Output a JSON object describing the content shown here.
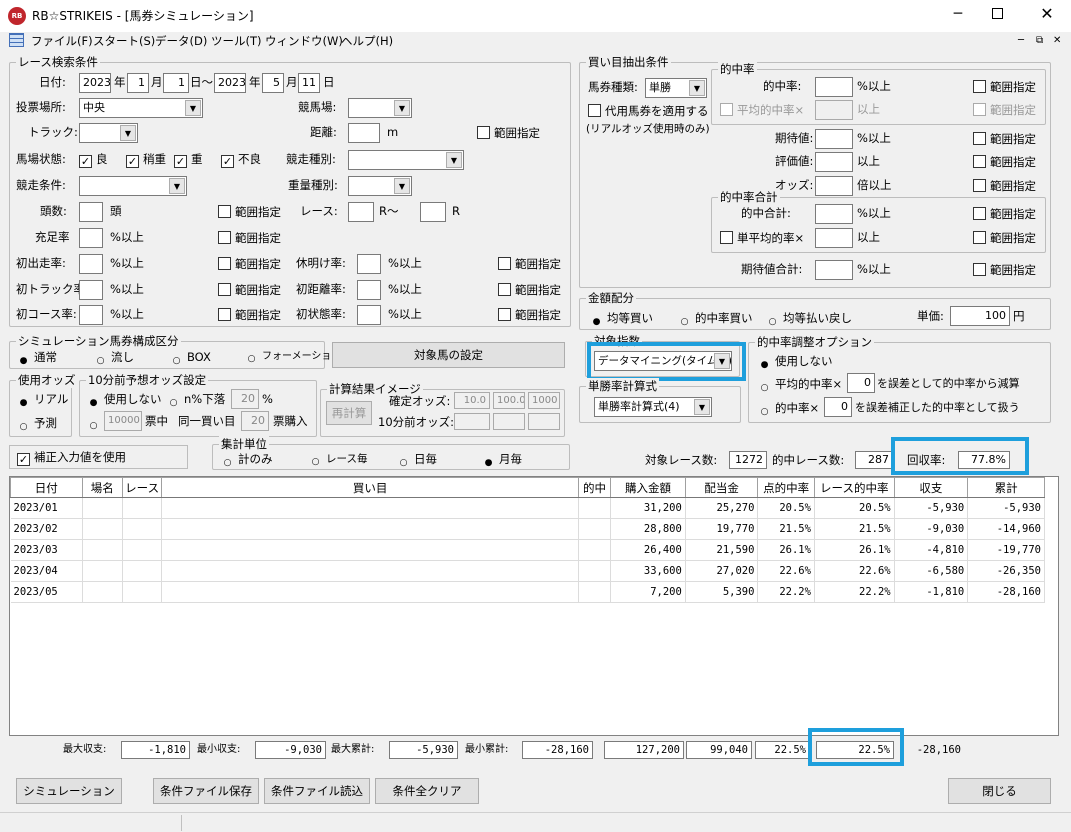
{
  "app_title": "RB☆STRIKEIS - [馬券シミュレーション]",
  "menu": [
    "ファイル(F)",
    "スタート(S)",
    "データ(D)",
    "ツール(T)",
    "ウィンドウ(W)",
    "ヘルプ(H)"
  ],
  "race": {
    "title": "レース検索条件",
    "date_label": "日付:",
    "y1": "2023",
    "year": "年",
    "m1": "1",
    "month": "月",
    "d1": "1",
    "day_sep": "日～",
    "y2": "2023",
    "m2": "5",
    "d2": "11",
    "day": "日",
    "venue_label": "投票場所:",
    "venue": "中央",
    "track_label": "競馬場:",
    "course_label": "トラック:",
    "dist_label": "距離:",
    "dist_unit": "m",
    "range": "範囲指定",
    "cond_label": "馬場状態:",
    "cond": [
      "良",
      "稍重",
      "重",
      "不良"
    ],
    "kind_label": "競走種別:",
    "cond2_label": "競走条件:",
    "weight_label": "重量種別:",
    "heads_label": "頭数:",
    "heads_unit": "頭",
    "race_label": "レース:",
    "race_unit1": "R～",
    "race_unit2": "R",
    "fill_label": "充足率",
    "pct_above": "%以上",
    "rows": [
      {
        "a": "初出走率:",
        "b": "休明け率:"
      },
      {
        "a": "初トラック率:",
        "b": "初距離率:"
      },
      {
        "a": "初コース率:",
        "b": "初状態率:"
      }
    ]
  },
  "buy": {
    "title": "買い目抽出条件",
    "type_label": "馬券種類:",
    "type": "単勝",
    "substitute": "代用馬券を適用する",
    "realodds": "(リアルオッズ使用時のみ)",
    "hit_group": "的中率",
    "hit_label": "的中率:",
    "hit_unit": "%以上",
    "avg_hit_label": "平均的中率×",
    "avg_hit_unit": "以上",
    "exp_label": "期待値:",
    "exp_unit": "%以上",
    "eval_label": "評価値:",
    "eval_unit": "以上",
    "odds_label": "オッズ:",
    "odds_unit": "倍以上",
    "total_group": "的中率合計",
    "total_label": "的中合計:",
    "total_unit": "%以上",
    "single_avg": "単平均的率×",
    "single_unit": "以上",
    "exp_total_label": "期待値合計:",
    "exp_total_unit": "%以上",
    "range": "範囲指定"
  },
  "money": {
    "title": "金額配分",
    "opts": [
      "均等買い",
      "的中率買い",
      "均等払い戻し"
    ],
    "unit_label": "単価:",
    "unit_value": "100",
    "yen": "円"
  },
  "target": {
    "title": "対象指数",
    "value": "データマイニング(タイム型)"
  },
  "adjust": {
    "title": "的中率調整オプション",
    "opt1": "使用しない",
    "opt2": "平均的中率×",
    "opt2_val": "0",
    "opt2_tail": "を誤差として的中率から減算",
    "opt3": "的中率×",
    "opt3_val": "0",
    "opt3_tail": "を誤差補正した的中率として扱う"
  },
  "single": {
    "title": "単勝率計算式",
    "value": "単勝率計算式(4)"
  },
  "sim": {
    "title": "シミュレーション馬券構成区分",
    "opts": [
      "通常",
      "流し",
      "BOX",
      "フォーメーション"
    ],
    "target_btn": "対象馬の設定"
  },
  "odds": {
    "title": "使用オッズ",
    "opts": [
      "リアル",
      "予測"
    ]
  },
  "pre10": {
    "title": "10分前予想オッズ設定",
    "use_no": "使用しない",
    "drop": "n%下落",
    "drop_val": "20",
    "pct": "%",
    "v1": "10000",
    "ticket": "票中",
    "same": "同一買い目",
    "v2": "20",
    "buy": "票購入"
  },
  "calc": {
    "title": "計算結果イメージ",
    "recalc": "再計算",
    "fixed": "確定オッズ:",
    "pre": "10分前オッズ:",
    "f1": "10.0",
    "f2": "100.0",
    "f3": "1000"
  },
  "correction": "補正入力値を使用",
  "agg": {
    "title": "集計単位",
    "opts": [
      "計のみ",
      "レース毎",
      "日毎",
      "月毎"
    ]
  },
  "stats": {
    "races_label": "対象レース数:",
    "races": "1272",
    "hits_label": "的中レース数:",
    "hits": "287",
    "rec_label": "回収率:",
    "rec": "77.8%"
  },
  "table": {
    "headers": [
      "日付",
      "場名",
      "レース",
      "買い目",
      "的中",
      "購入金額",
      "配当金",
      "点的中率",
      "レース的中率",
      "収支",
      "累計"
    ],
    "rows": [
      [
        "2023/01",
        "",
        "",
        "",
        "",
        "31,200",
        "25,270",
        "20.5%",
        "20.5%",
        "-5,930",
        "-5,930"
      ],
      [
        "2023/02",
        "",
        "",
        "",
        "",
        "28,800",
        "19,770",
        "21.5%",
        "21.5%",
        "-9,030",
        "-14,960"
      ],
      [
        "2023/03",
        "",
        "",
        "",
        "",
        "26,400",
        "21,590",
        "26.1%",
        "26.1%",
        "-4,810",
        "-19,770"
      ],
      [
        "2023/04",
        "",
        "",
        "",
        "",
        "33,600",
        "27,020",
        "22.6%",
        "22.6%",
        "-6,580",
        "-26,350"
      ],
      [
        "2023/05",
        "",
        "",
        "",
        "",
        "7,200",
        "5,390",
        "22.2%",
        "22.2%",
        "-1,810",
        "-28,160"
      ]
    ]
  },
  "summary": {
    "max_bal_l": "最大収支:",
    "max_bal": "-1,810",
    "min_bal_l": "最小収支:",
    "min_bal": "-9,030",
    "max_cum_l": "最大累計:",
    "max_cum": "-5,930",
    "min_cum_l": "最小累計:",
    "min_cum": "-28,160",
    "buy": "127,200",
    "pay": "99,040",
    "hit": "22.5%",
    "race_hit": "22.5%",
    "total": "-28,160"
  },
  "buttons": {
    "sim": "シミュレーション",
    "save": "条件ファイル保存",
    "load": "条件ファイル読込",
    "clear": "条件全クリア",
    "close": "閉じる"
  },
  "colors": {
    "highlight": "#1e9fdc"
  }
}
